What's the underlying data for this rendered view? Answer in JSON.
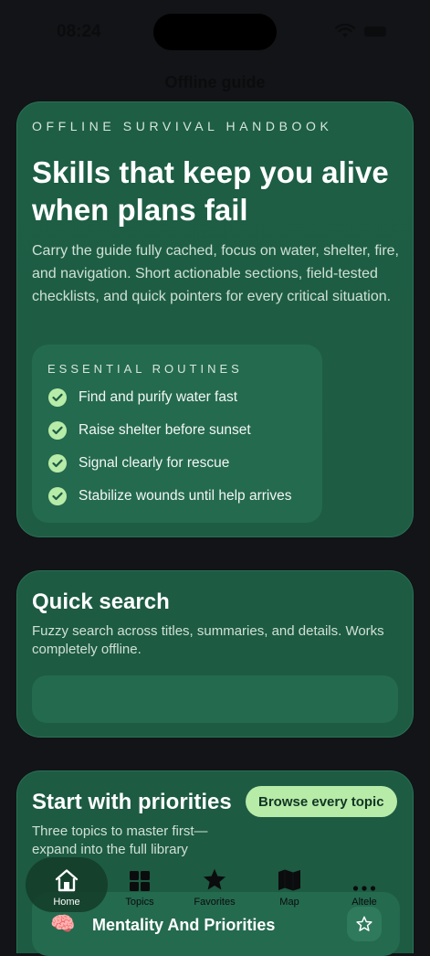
{
  "status": {
    "time": "08:24"
  },
  "nav": {
    "title": "Offline guide"
  },
  "hero": {
    "eyebrow": "OFFLINE SURVIVAL HANDBOOK",
    "title": "Skills that keep you alive when plans fail",
    "description": "Carry the guide fully cached, focus on water, shelter, fire, and navigation. Short actionable sections, field-tested checklists, and quick pointers for every critical situation.",
    "routines_title": "ESSENTIAL ROUTINES",
    "routines": [
      "Find and purify water fast",
      "Raise shelter before sunset",
      "Signal clearly for rescue",
      "Stabilize wounds until help arrives"
    ]
  },
  "search": {
    "title": "Quick search",
    "description": "Fuzzy search across titles, summaries, and details. Works completely offline.",
    "value": "",
    "placeholder": ""
  },
  "priorities": {
    "title": "Start with priorities",
    "browse_label": "Browse every topic",
    "description": "Three topics to master first—expand into the full library",
    "topic": {
      "emoji": "🧠",
      "label": "Mentality And Priorities"
    }
  },
  "tabs": [
    {
      "label": "Home",
      "icon": "home-icon",
      "active": true
    },
    {
      "label": "Topics",
      "icon": "grid-icon",
      "active": false
    },
    {
      "label": "Favorites",
      "icon": "star-icon",
      "active": false
    },
    {
      "label": "Map",
      "icon": "map-icon",
      "active": false
    },
    {
      "label": "Altele",
      "icon": "more-icon",
      "active": false
    }
  ],
  "colors": {
    "card": "#1d5b43",
    "accent": "#b7eba8",
    "background": "#121417"
  }
}
